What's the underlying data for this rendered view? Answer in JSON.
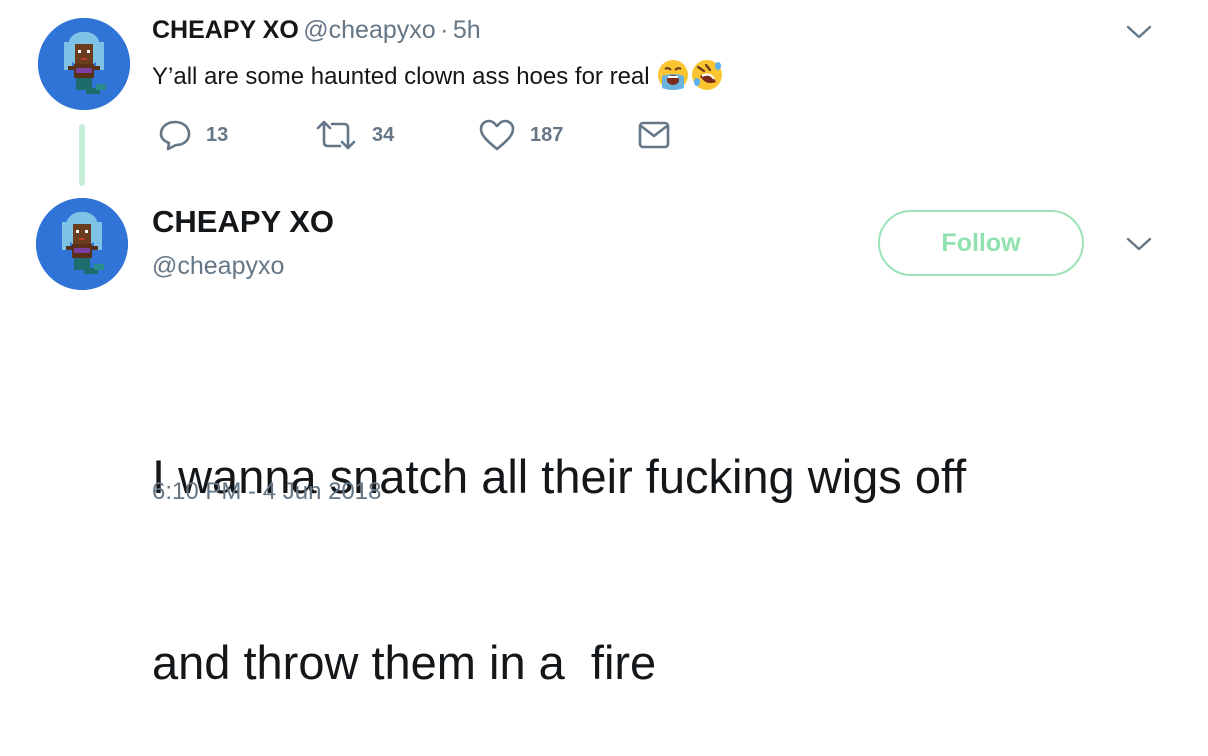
{
  "tweet1": {
    "name": "CHEAPY XO",
    "handle": "@cheapyxo",
    "separator": "·",
    "age": "5h",
    "text": "Y’all are some haunted clown ass hoes for real",
    "emojis": [
      "crying-face-emoji",
      "rolling-laughing-face-emoji"
    ],
    "actions": {
      "replies": "13",
      "retweets": "34",
      "likes": "187"
    }
  },
  "tweet2": {
    "name": "CHEAPY XO",
    "handle": "@cheapyxo",
    "follow_label": "Follow",
    "text_line1": "I wanna snatch all their fucking wigs off",
    "text_line2": "and throw them in a  fire",
    "timestamp": "6:10 PM - 4 Jun 2018"
  },
  "colors": {
    "follow_accent": "#9ce3b9",
    "thread_line": "#c7eed8",
    "muted_text": "#657786",
    "avatar_bg": "#2a6fd0"
  }
}
